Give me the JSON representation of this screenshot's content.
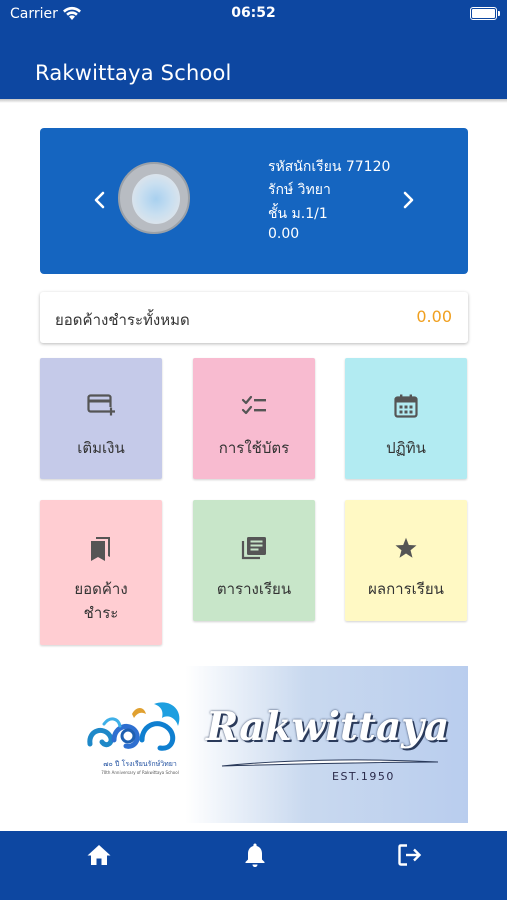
{
  "status_bar": {
    "carrier": "Carrier",
    "time": "06:52"
  },
  "header": {
    "title": "Rakwittaya School"
  },
  "student": {
    "student_id_line": "รหัสนักเรียน 77120",
    "name": "รักษ์ วิทยา",
    "class_line": "ชั้น ม.1/1",
    "balance": "0.00"
  },
  "outstanding": {
    "label": "ยอดค้างชำระทั้งหมด",
    "value": "0.00",
    "value_color": "#f0a020"
  },
  "menu": [
    {
      "label": "เติมเงิน",
      "icon": "card-add-icon",
      "color": "#c5cae9"
    },
    {
      "label": "การใช้บัตร",
      "icon": "checklist-icon",
      "color": "#f8bbd0"
    },
    {
      "label": "ปฏิทิน",
      "icon": "calendar-icon",
      "color": "#b2ebf2"
    },
    {
      "label": "ยอดค้าง\nชำระ",
      "icon": "bookmarks-icon",
      "color": "#ffcdd2"
    },
    {
      "label": "ตารางเรียน",
      "icon": "library-books-icon",
      "color": "#c8e6c9"
    },
    {
      "label": "ผลการเรียน",
      "icon": "star-icon",
      "color": "#fff9c4"
    }
  ],
  "banner": {
    "brand": "Rakwittaya",
    "est": "EST.1950",
    "logo_caption_thai": "๗๐ ปี โรงเรียนรักษ์วิทยา",
    "logo_caption_en": "70th Anniversary of Rakwittaya School"
  },
  "bottom_nav": [
    {
      "icon": "home-icon"
    },
    {
      "icon": "bell-icon"
    },
    {
      "icon": "logout-icon"
    }
  ],
  "colors": {
    "primary": "#0d47a1",
    "card": "#1565c0",
    "accent": "#f0a020"
  }
}
